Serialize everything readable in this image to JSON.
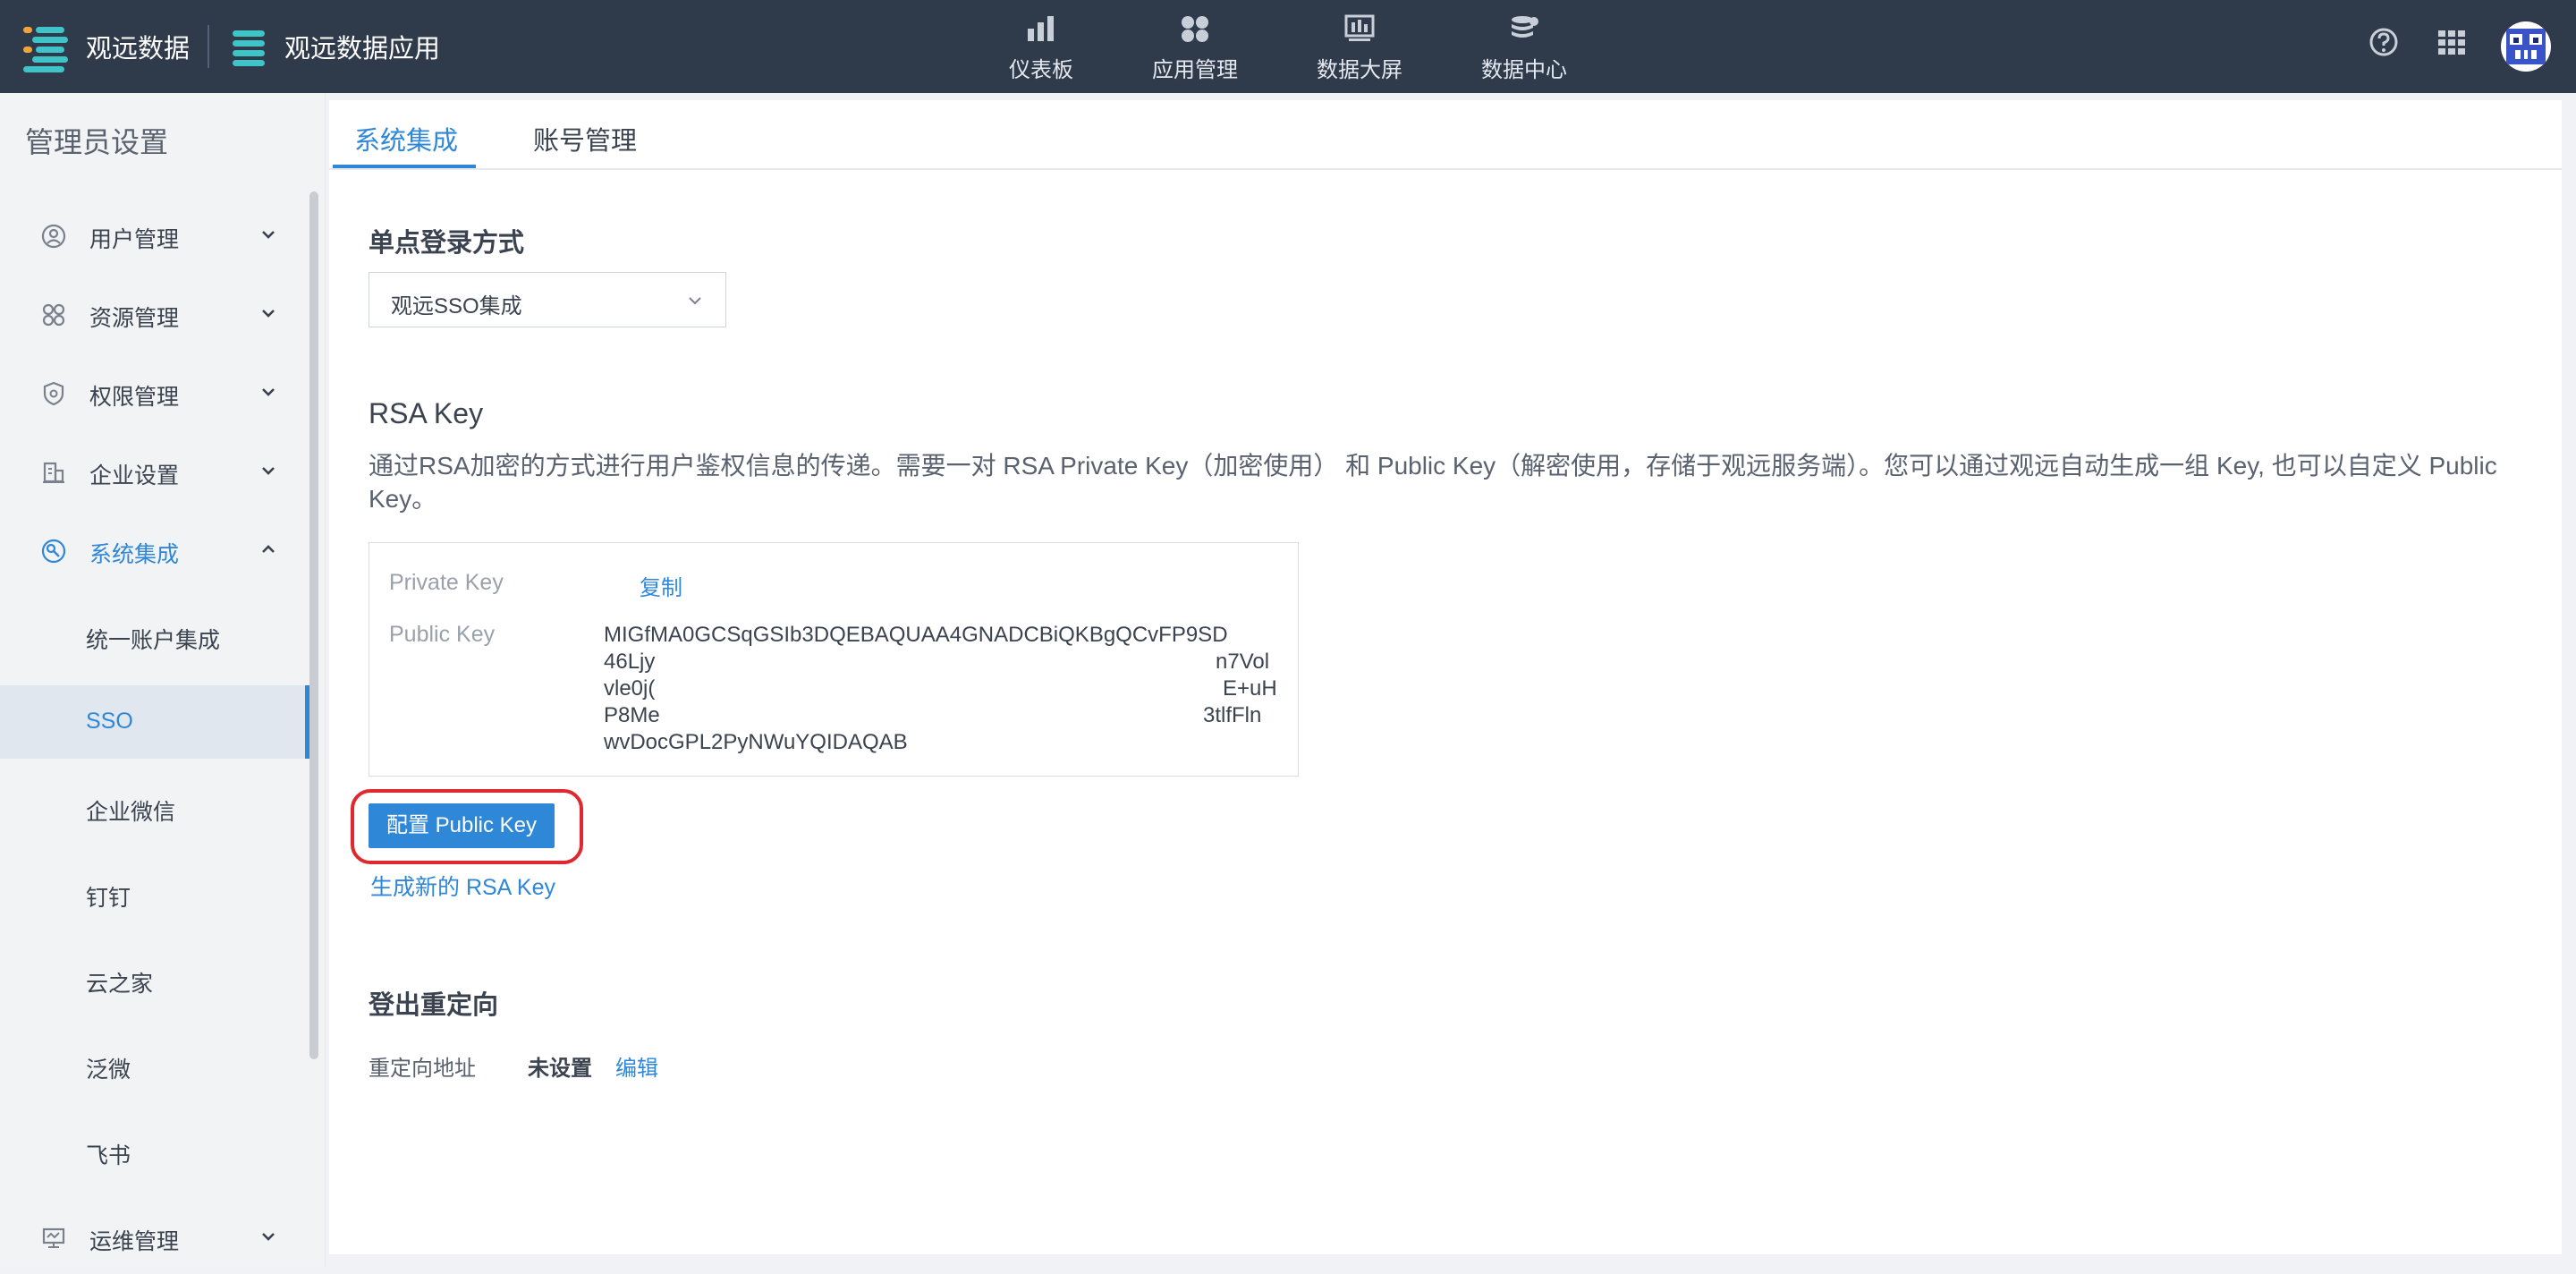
{
  "topbar": {
    "brand1": "观远数据",
    "brand2": "观远数据应用",
    "nav": [
      {
        "label": "仪表板",
        "icon": "bar-chart-icon"
      },
      {
        "label": "应用管理",
        "icon": "apps-grid-icon"
      },
      {
        "label": "数据大屏",
        "icon": "dashboard-screen-icon"
      },
      {
        "label": "数据中心",
        "icon": "database-icon"
      }
    ],
    "tools": [
      "help-icon",
      "app-launcher-icon",
      "user-avatar"
    ]
  },
  "sidebar": {
    "title": "管理员设置",
    "items": [
      {
        "label": "用户管理",
        "icon": "user-icon"
      },
      {
        "label": "资源管理",
        "icon": "resource-grid-icon"
      },
      {
        "label": "权限管理",
        "icon": "shield-icon"
      },
      {
        "label": "企业设置",
        "icon": "building-icon"
      },
      {
        "label": "系统集成",
        "icon": "integration-icon",
        "expanded": true
      }
    ],
    "subitems": [
      "统一账户集成",
      "SSO",
      "企业微信",
      "钉钉",
      "云之家",
      "泛微",
      "飞书"
    ],
    "selected_subitem": "SSO",
    "last_item": {
      "label": "运维管理",
      "icon": "monitor-icon"
    }
  },
  "tabs": [
    {
      "label": "系统集成",
      "active": true
    },
    {
      "label": "账号管理",
      "active": false
    }
  ],
  "sso": {
    "section_title": "单点登录方式",
    "selected_method": "观远SSO集成"
  },
  "rsa": {
    "title": "RSA Key",
    "description": "通过RSA加密的方式进行用户鉴权信息的传递。需要一对 RSA Private Key（加密使用） 和 Public Key（解密使用，存储于观远服务端）。您可以通过观远自动生成一组 Key, 也可以自定义 Public Key。",
    "private_key_label": "Private Key",
    "copy_label": "复制",
    "public_key_label": "Public Key",
    "public_key_lines": [
      "MIGfMA0GCSqGSIb3DQEBAQUAA4GNADCBiQKBgQCvFP9SD",
      "46Ljy",
      "n7Vol",
      "vle0j(",
      "E+uH",
      "P8Me",
      "3tlfFln",
      "wvDocGPL2PyNWuYQIDAQAB"
    ],
    "configure_button": "配置 Public Key",
    "generate_link": "生成新的 RSA Key"
  },
  "logout": {
    "section_title": "登出重定向",
    "redirect_label": "重定向地址",
    "redirect_value": "未设置",
    "edit_link": "编辑"
  },
  "colors": {
    "topbar_bg": "#2f3a4b",
    "accent": "#2f87d8",
    "highlight": "#e0282e"
  }
}
